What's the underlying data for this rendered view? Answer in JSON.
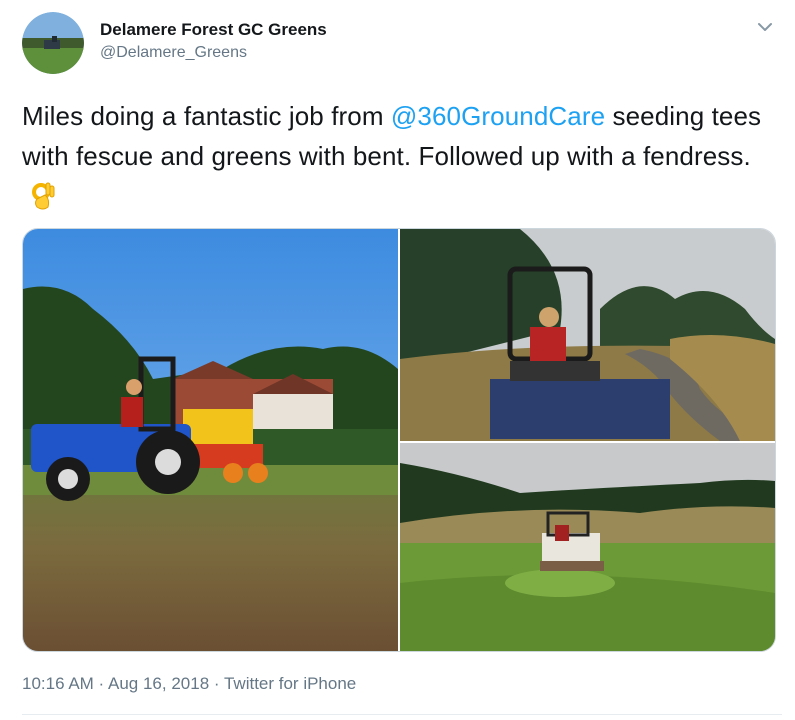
{
  "tweet": {
    "author": {
      "display_name": "Delamere Forest GC Greens",
      "handle": "@Delamere_Greens"
    },
    "text_before": "Miles doing a fantastic job from ",
    "mention": "@360GroundCare",
    "text_after": " seeding tees with fescue and greens with bent. Followed up with a fendress.",
    "emoji": "ok-hand-emoji",
    "time": "10:16 AM",
    "date": "Aug 16, 2018",
    "source": "Twitter for iPhone",
    "separator": " · "
  },
  "icons": {
    "more": "chevron-down-icon"
  },
  "colors": {
    "link": "#1da1f2",
    "secondary_text": "#657786",
    "border": "#ccd6dd"
  }
}
